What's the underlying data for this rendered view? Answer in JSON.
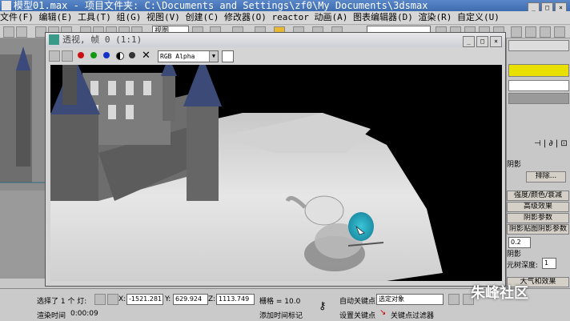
{
  "window": {
    "title": "模型01.max   - 项目文件夹: C:\\Documents and Settings\\zf0\\My Documents\\3dsmax",
    "min": "_",
    "max": "□",
    "close": "×"
  },
  "menu": [
    "文件(F)",
    "编辑(E)",
    "工具(T)",
    "组(G)",
    "视图(V)",
    "创建(C)",
    "修改器(O)",
    "reactor",
    "动画(A)",
    "图表编辑器(D)",
    "渲染(R)",
    "自定义(U)"
  ],
  "toolbar": {
    "view_select": "视图"
  },
  "render_window": {
    "title": "透视, 帧 0 (1:1)",
    "channel": "RGB Alpha",
    "colors": {
      "red": "#cc1111",
      "green": "#119911",
      "blue": "#1133cc"
    }
  },
  "cmd_panel": {
    "shadow_label": "阴影",
    "exclude": "排除...",
    "rollouts": [
      "强度/颜色/衰减",
      "高级效果",
      "阴影参数",
      "阴影贴图阴影参数"
    ],
    "bias": "0.2",
    "shadow_text": "阴影",
    "prim_depth_label": "元树深度:",
    "prim_depth": "1",
    "atmos": "大气和效果"
  },
  "status": {
    "selected": "选择了 1 个 灯:",
    "x_label": "X:",
    "x": "-1521.281",
    "y_label": "Y:",
    "y": "629.924",
    "z_label": "Z:",
    "z": "1113.749",
    "grid": "栅格 = 10.0",
    "auto_key": "自动关键点",
    "selected_obj": "选定对象",
    "render_time_label": "渲染时间",
    "render_time": "0:00:09",
    "add_time_tag": "添加时间标记",
    "set_key": "设置关键点",
    "key_filter": "关键点过滤器"
  },
  "watermark": "朱峰社区"
}
